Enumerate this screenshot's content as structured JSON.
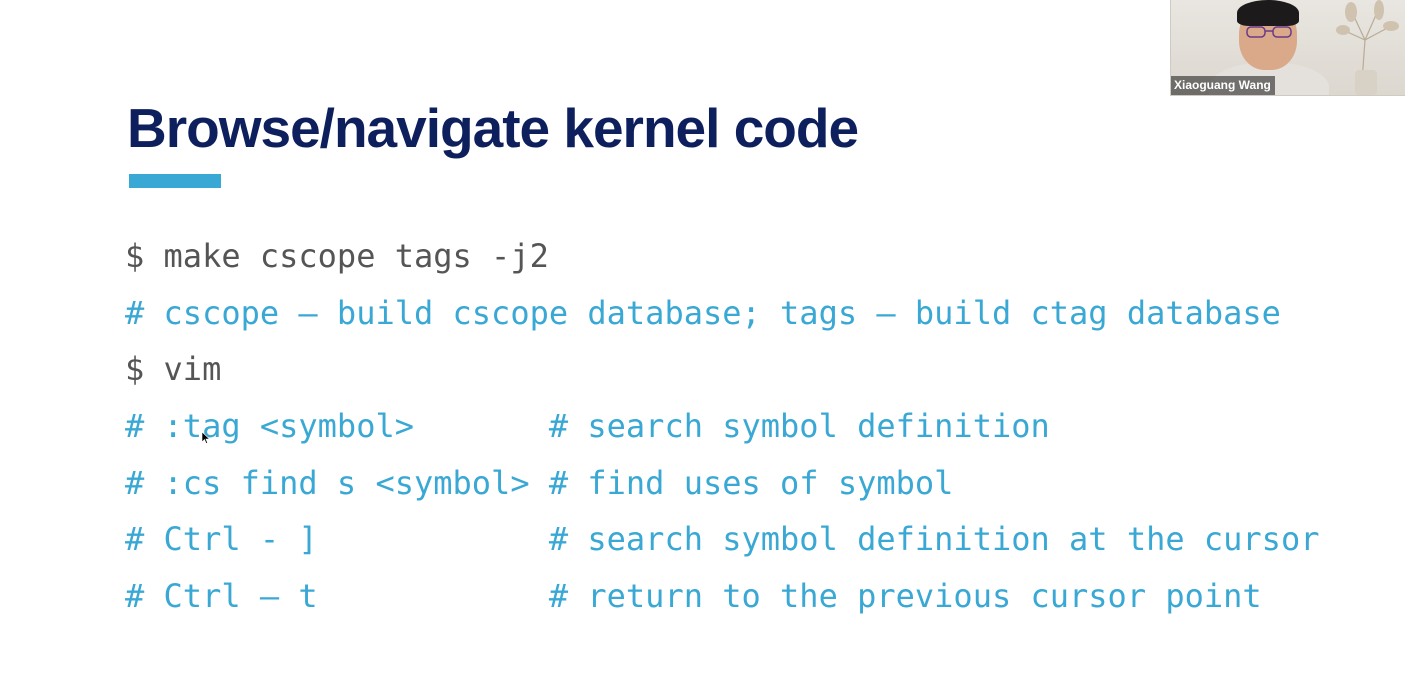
{
  "slide": {
    "title": "Browse/navigate kernel code",
    "colors": {
      "title": "#0d1f5c",
      "accent": "#3aa8d4",
      "command": "#555555",
      "comment": "#3aa8d4"
    },
    "lines": [
      {
        "kind": "command",
        "text": "$ make cscope tags -j2"
      },
      {
        "kind": "comment",
        "text": "# cscope – build cscope database; tags – build ctag database"
      },
      {
        "kind": "command",
        "text": "$ vim"
      },
      {
        "kind": "comment",
        "text": "# :tag <symbol>       # search symbol definition"
      },
      {
        "kind": "comment",
        "text": "# :cs find s <symbol> # find uses of symbol"
      },
      {
        "kind": "comment",
        "text": "# Ctrl - ]            # search symbol definition at the cursor"
      },
      {
        "kind": "comment",
        "text": "# Ctrl – t            # return to the previous cursor point"
      }
    ]
  },
  "video": {
    "participant_name": "Xiaoguang Wang"
  },
  "icons": {
    "mouse_cursor": "arrow-cursor-icon"
  }
}
